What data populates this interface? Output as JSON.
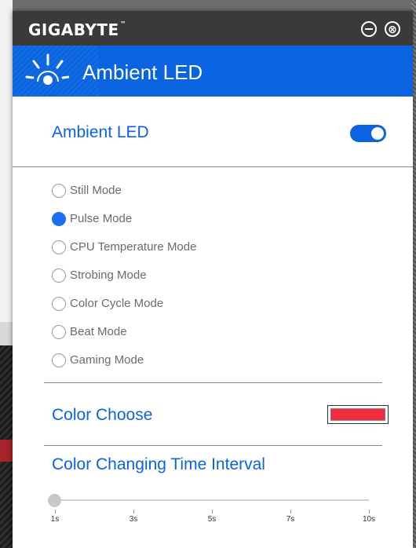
{
  "window": {
    "brand": "GIGABYTE",
    "brand_tm": "™",
    "close_glyph": "⊗"
  },
  "header": {
    "title": "Ambient LED",
    "icon": "ambient-led-icon"
  },
  "ambient_led": {
    "label": "Ambient LED",
    "enabled": true
  },
  "modes": [
    {
      "label": "Still Mode",
      "selected": false
    },
    {
      "label": "Pulse Mode",
      "selected": true
    },
    {
      "label": "CPU Temperature Mode",
      "selected": false
    },
    {
      "label": "Strobing Mode",
      "selected": false
    },
    {
      "label": "Color Cycle Mode",
      "selected": false
    },
    {
      "label": "Beat Mode",
      "selected": false
    },
    {
      "label": "Gaming Mode",
      "selected": false
    }
  ],
  "color_choose": {
    "label": "Color Choose",
    "color": "#f22a3f"
  },
  "interval": {
    "label": "Color Changing Time Interval",
    "ticks": [
      "1s",
      "3s",
      "5s",
      "7s",
      "10s"
    ],
    "value": "1s"
  },
  "colors": {
    "accent": "#0a63e0",
    "titlebar": "#3a3a3a"
  }
}
